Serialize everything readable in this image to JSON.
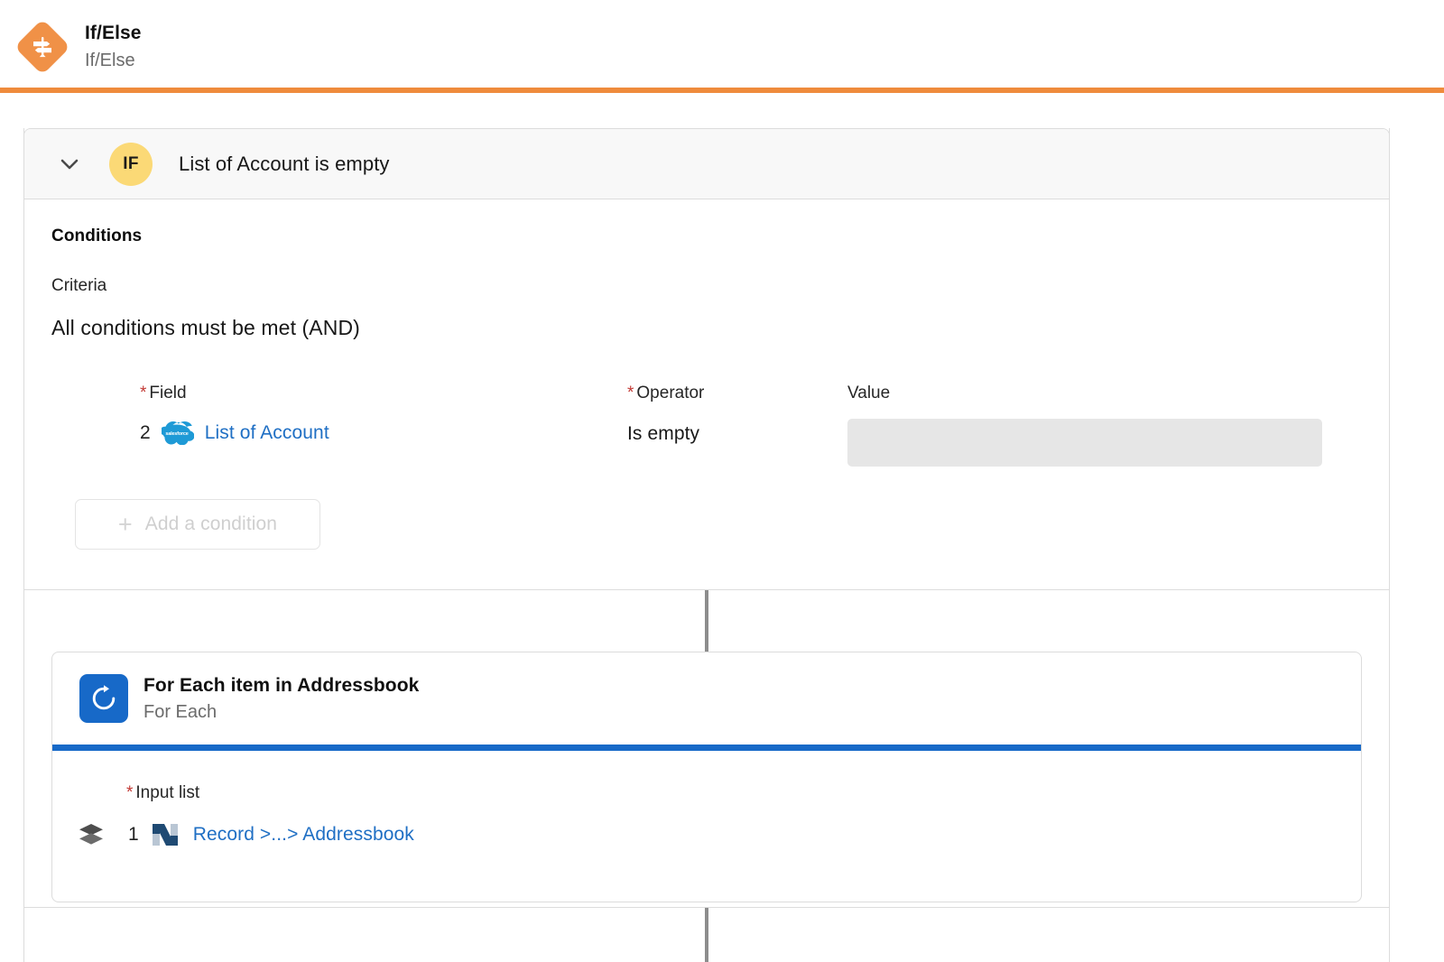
{
  "header": {
    "icon": "if-else-signpost-icon",
    "title": "If/Else",
    "subtitle": "If/Else",
    "accent_color": "#ef8b3c"
  },
  "if_card": {
    "chevron_icon": "chevron-down-icon",
    "badge_label": "IF",
    "badge_color": "#fbd976",
    "title": "List of Account is empty"
  },
  "conditions": {
    "heading": "Conditions",
    "criteria_label": "Criteria",
    "criteria_value": "All conditions must be met (AND)",
    "columns": {
      "field_label": "Field",
      "field_required": "*",
      "operator_label": "Operator",
      "operator_required": "*",
      "value_label": "Value"
    },
    "rows": [
      {
        "index": "2",
        "field_icon": "salesforce-cloud-icon",
        "field_text": "List of Account",
        "operator_text": "Is empty",
        "value_text": "",
        "value_placeholder": ""
      }
    ],
    "add_condition": {
      "icon": "plus-icon",
      "label": "Add a condition",
      "disabled": true
    }
  },
  "for_each": {
    "icon": "loop-refresh-icon",
    "title": "For Each item in Addressbook",
    "subtitle": "For Each",
    "accent_color": "#1769c8",
    "input_list": {
      "label": "Input list",
      "required": "*",
      "index": "1",
      "layers_icon": "layers-stack-icon",
      "source_icon": "netsuite-n-icon",
      "text": "Record >...> Addressbook"
    }
  }
}
